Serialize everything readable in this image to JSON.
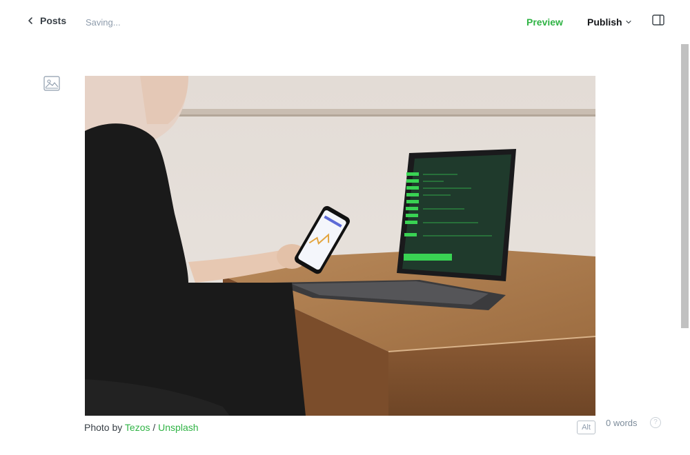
{
  "header": {
    "back_label": "Posts",
    "status": "Saving...",
    "preview_label": "Preview",
    "publish_label": "Publish"
  },
  "image_card": {
    "caption_prefix": "Photo by ",
    "author": "Tezos",
    "separator": " / ",
    "source": "Unsplash",
    "alt_label": "Alt"
  },
  "footer": {
    "word_count": "0 words",
    "help_label": "?"
  },
  "colors": {
    "accent": "#2fb344",
    "text": "#15171a",
    "muted": "#8e9cac"
  }
}
